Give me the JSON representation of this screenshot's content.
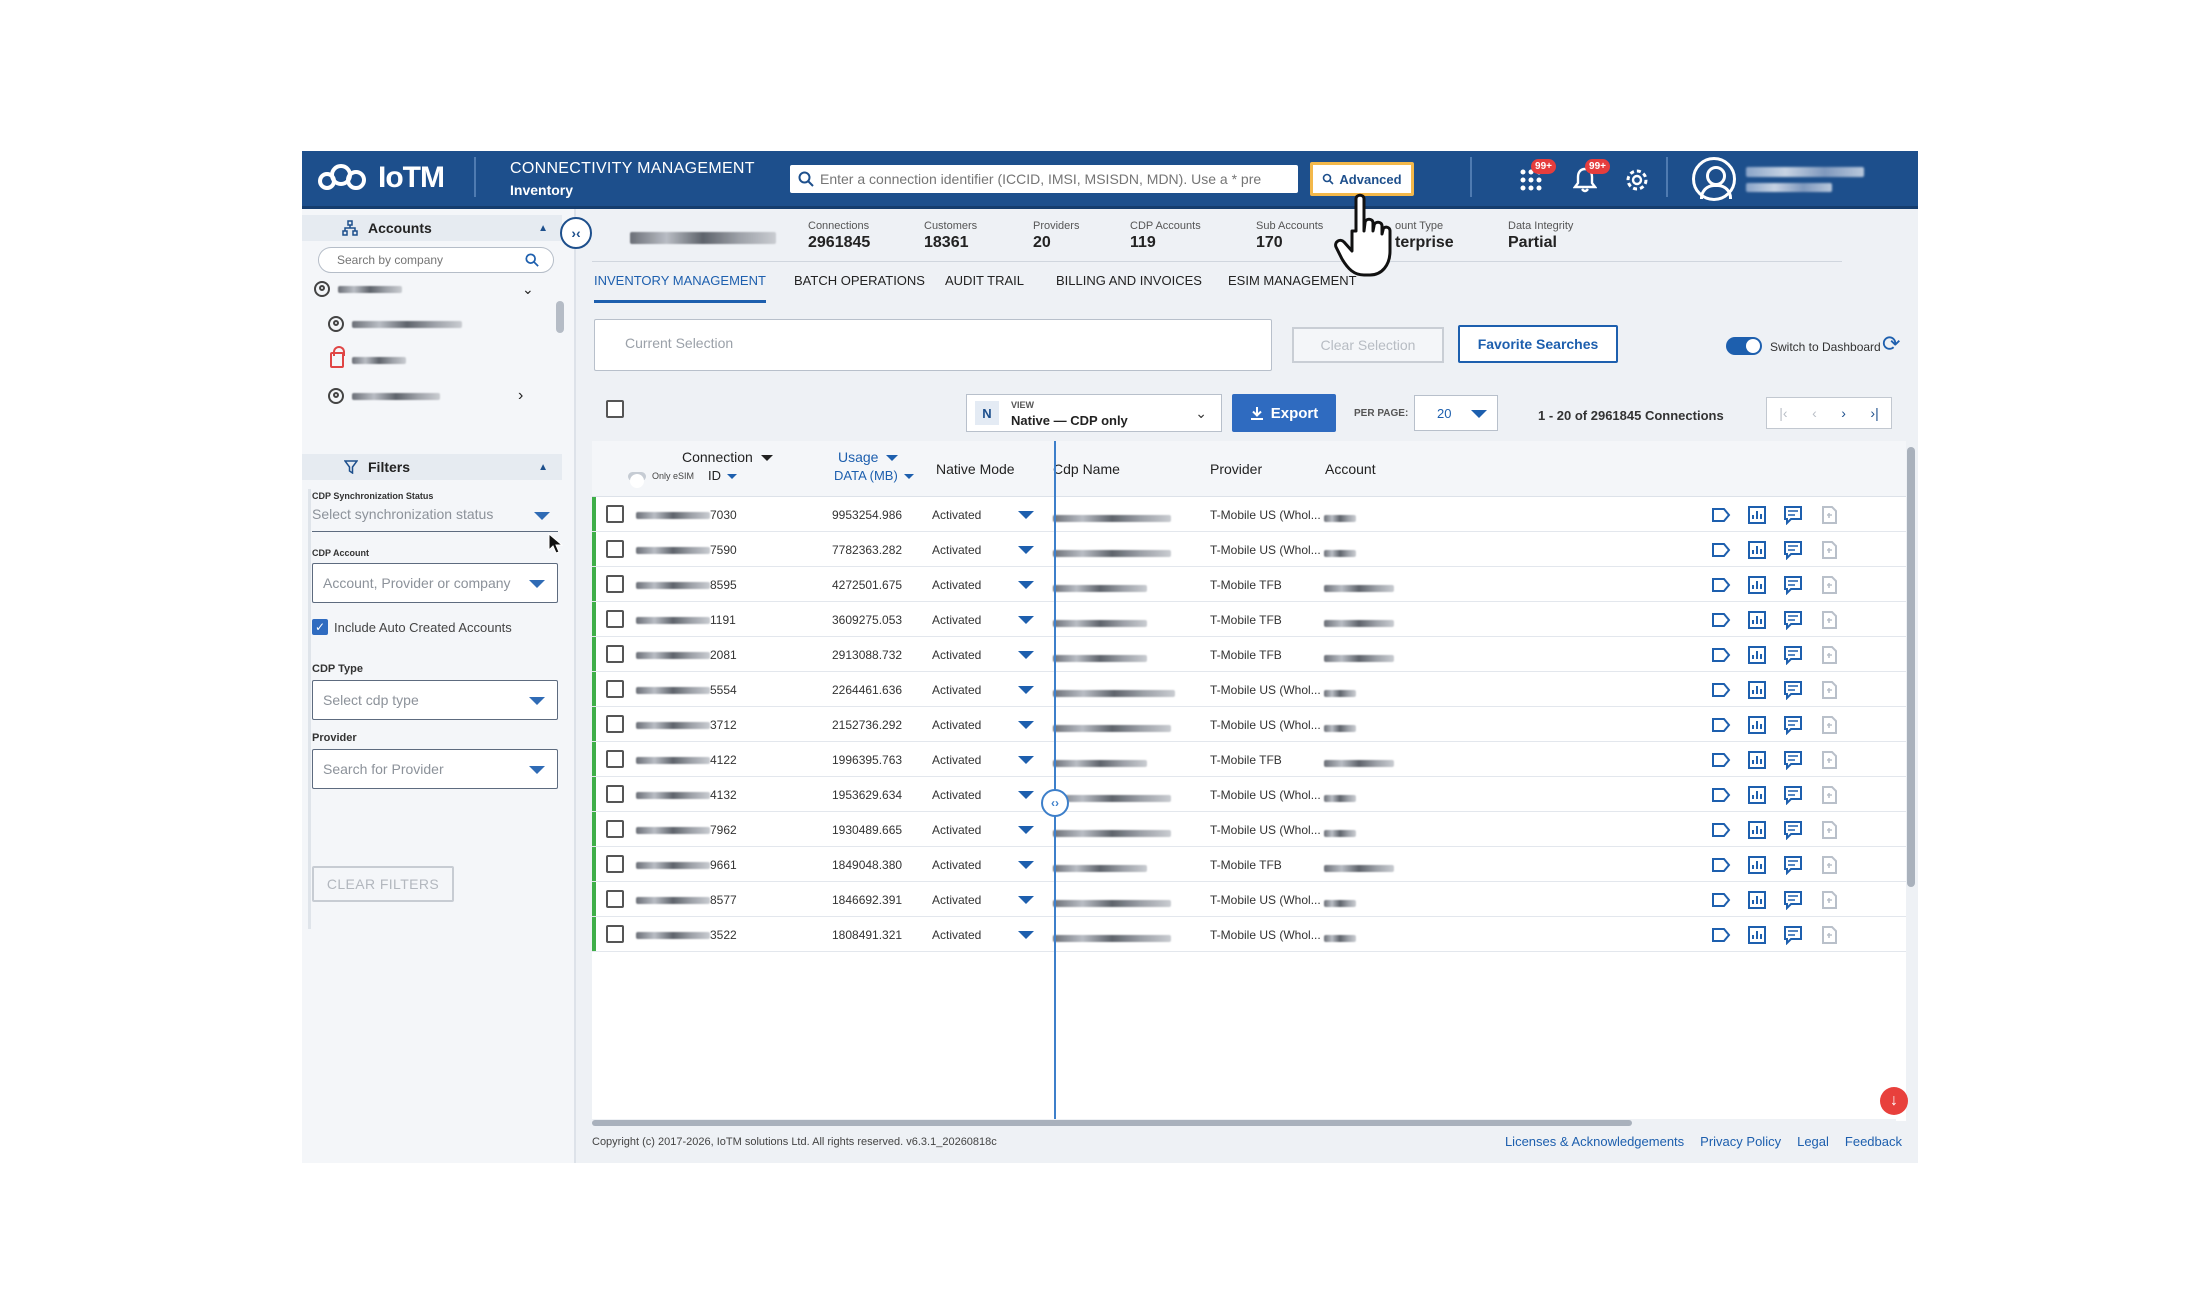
{
  "header": {
    "brand": "IoTM",
    "module_title": "CONNECTIVITY MANAGEMENT",
    "module_subtitle": "Inventory",
    "search_placeholder": "Enter a connection identifier (ICCID, IMSI, MSISDN, MDN). Use a * pre",
    "advanced_label": "Advanced",
    "apps_badge": "99+",
    "notifications_badge": "99+",
    "icons": [
      "search-icon",
      "apps-grid-icon",
      "bell-icon",
      "gear-icon",
      "user-avatar-icon"
    ]
  },
  "sidebar": {
    "accounts_label": "Accounts",
    "company_search_placeholder": "Search by company",
    "filters_label": "Filters",
    "cdp_sync_label": "CDP Synchronization Status",
    "cdp_sync_placeholder": "Select synchronization status",
    "cdp_account_label": "CDP Account",
    "cdp_account_placeholder": "Account, Provider or company",
    "include_auto_label": "Include Auto Created Accounts",
    "include_auto_checked": true,
    "cdp_type_label": "CDP Type",
    "cdp_type_placeholder": "Select cdp type",
    "provider_label": "Provider",
    "provider_placeholder": "Search for Provider",
    "clear_filters_label": "CLEAR FILTERS"
  },
  "stats": [
    {
      "label": "Connections",
      "value": "2961845"
    },
    {
      "label": "Customers",
      "value": "18361"
    },
    {
      "label": "Providers",
      "value": "20"
    },
    {
      "label": "CDP Accounts",
      "value": "119"
    },
    {
      "label": "Sub Accounts",
      "value": "170"
    },
    {
      "label": "ount Type",
      "value": "terprise"
    },
    {
      "label": "Data Integrity",
      "value": "Partial"
    }
  ],
  "tabs": [
    "INVENTORY MANAGEMENT",
    "BATCH OPERATIONS",
    "AUDIT TRAIL",
    "BILLING AND INVOICES",
    "ESIM MANAGEMENT"
  ],
  "active_tab": "INVENTORY MANAGEMENT",
  "toolbar": {
    "current_selection_placeholder": "Current Selection",
    "clear_selection_label": "Clear Selection",
    "favorite_searches_label": "Favorite Searches",
    "switch_dashboard_label": "Switch to Dashboard",
    "view_badge": "N",
    "view_caption": "VIEW",
    "view_value": "Native — CDP only",
    "export_label": "Export",
    "per_page_label": "PER PAGE:",
    "per_page_value": "20",
    "range_text": "1 - 20 of 2961845 Connections"
  },
  "table": {
    "headers": {
      "connection": "Connection",
      "only_esim": "Only eSIM",
      "id": "ID",
      "usage": "Usage",
      "data_mb": "DATA (MB)",
      "native_mode": "Native Mode",
      "cdp_name": "Cdp Name",
      "provider": "Provider",
      "account": "Account"
    },
    "rows": [
      {
        "id_suffix": "7030",
        "usage": "9953254.986",
        "mode": "Activated",
        "provider": "T-Mobile US (Whol..."
      },
      {
        "id_suffix": "7590",
        "usage": "7782363.282",
        "mode": "Activated",
        "provider": "T-Mobile US (Whol..."
      },
      {
        "id_suffix": "8595",
        "usage": "4272501.675",
        "mode": "Activated",
        "provider": "T-Mobile TFB"
      },
      {
        "id_suffix": "1191",
        "usage": "3609275.053",
        "mode": "Activated",
        "provider": "T-Mobile TFB"
      },
      {
        "id_suffix": "2081",
        "usage": "2913088.732",
        "mode": "Activated",
        "provider": "T-Mobile TFB"
      },
      {
        "id_suffix": "5554",
        "usage": "2264461.636",
        "mode": "Activated",
        "provider": "T-Mobile US (Whol..."
      },
      {
        "id_suffix": "3712",
        "usage": "2152736.292",
        "mode": "Activated",
        "provider": "T-Mobile US (Whol..."
      },
      {
        "id_suffix": "4122",
        "usage": "1996395.763",
        "mode": "Activated",
        "provider": "T-Mobile TFB"
      },
      {
        "id_suffix": "4132",
        "usage": "1953629.634",
        "mode": "Activated",
        "provider": "T-Mobile US (Whol..."
      },
      {
        "id_suffix": "7962",
        "usage": "1930489.665",
        "mode": "Activated",
        "provider": "T-Mobile US (Whol..."
      },
      {
        "id_suffix": "9661",
        "usage": "1849048.380",
        "mode": "Activated",
        "provider": "T-Mobile TFB"
      },
      {
        "id_suffix": "8577",
        "usage": "1846692.391",
        "mode": "Activated",
        "provider": "T-Mobile US (Whol..."
      },
      {
        "id_suffix": "3522",
        "usage": "1808491.321",
        "mode": "Activated",
        "provider": "T-Mobile US (Whol..."
      }
    ]
  },
  "footer": {
    "copyright": "Copyright (c) 2017-2026, IoTM solutions Ltd. All rights reserved. v6.3.1_20260818c",
    "links": [
      "Licenses & Acknowledgements",
      "Privacy Policy",
      "Legal",
      "Feedback"
    ]
  },
  "colors": {
    "brand": "#1d4f8c",
    "accent": "#1d5fae",
    "active_row": "#3fae49",
    "alert": "#e8403c",
    "highlight": "#f3b84a"
  }
}
